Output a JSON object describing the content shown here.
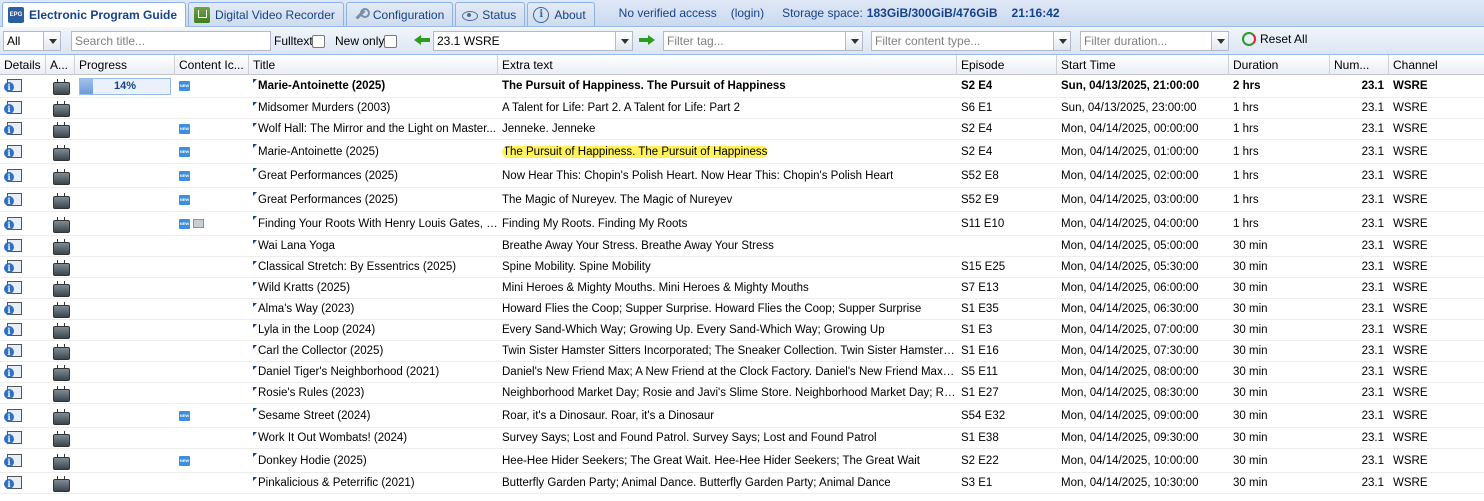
{
  "tabs": [
    {
      "label": "Electronic Program Guide",
      "icon": "epg-icon",
      "icon_text": "EPG",
      "active": true
    },
    {
      "label": "Digital Video Recorder",
      "icon": "dvr-icon",
      "active": false
    },
    {
      "label": "Configuration",
      "icon": "wrench-icon",
      "active": false
    },
    {
      "label": "Status",
      "icon": "eye-icon",
      "active": false
    },
    {
      "label": "About",
      "icon": "info-icon",
      "active": false
    }
  ],
  "status_bar": {
    "access": "No verified access",
    "login": "(login)",
    "storage_label": "Storage space:",
    "storage_value": "183GiB/300GiB/476GiB",
    "clock": "21:16:42"
  },
  "toolbar": {
    "channel_tag_value": "All",
    "search_placeholder": "Search title...",
    "fulltext_label": "Fulltext",
    "new_only_label": "New only",
    "channel_value": "23.1 WSRE",
    "tag_placeholder": "Filter tag...",
    "content_type_placeholder": "Filter content type...",
    "duration_placeholder": "Filter duration...",
    "reset_label": "Reset All"
  },
  "columns": [
    "Details",
    "A...",
    "Progress",
    "Content Ic...",
    "Title",
    "Extra text",
    "Episode",
    "Start Time",
    "Duration",
    "Num...",
    "Channel"
  ],
  "rows": [
    {
      "title": "Marie-Antoinette (2025)",
      "extra": "The Pursuit of Happiness. The Pursuit of Happiness",
      "episode": "S2 E4",
      "start": "Sun, 04/13/2025, 21:00:00",
      "duration": "2 hrs",
      "num": "23.1",
      "channel": "WSRE",
      "bold": true,
      "progress": 14,
      "progress_label": "14%",
      "new": true,
      "cc": false,
      "highlight": false
    },
    {
      "title": "Midsomer Murders (2003)",
      "extra": "A Talent for Life: Part 2. A Talent for Life: Part 2",
      "episode": "S6 E1",
      "start": "Sun, 04/13/2025, 23:00:00",
      "duration": "1 hrs",
      "num": "23.1",
      "channel": "WSRE",
      "bold": false,
      "new": false,
      "cc": false,
      "highlight": false
    },
    {
      "title": "Wolf Hall: The Mirror and the Light on Master...",
      "extra": "Jenneke. Jenneke",
      "episode": "S2 E4",
      "start": "Mon, 04/14/2025, 00:00:00",
      "duration": "1 hrs",
      "num": "23.1",
      "channel": "WSRE",
      "bold": false,
      "new": true,
      "cc": false,
      "highlight": false
    },
    {
      "title": "Marie-Antoinette (2025)",
      "extra": "The Pursuit of Happiness. The Pursuit of Happiness",
      "episode": "S2 E4",
      "start": "Mon, 04/14/2025, 01:00:00",
      "duration": "1 hrs",
      "num": "23.1",
      "channel": "WSRE",
      "bold": false,
      "new": true,
      "cc": false,
      "highlight": true
    },
    {
      "title": "Great Performances (2025)",
      "extra": "Now Hear This: Chopin's Polish Heart. Now Hear This: Chopin's Polish Heart",
      "episode": "S52 E8",
      "start": "Mon, 04/14/2025, 02:00:00",
      "duration": "1 hrs",
      "num": "23.1",
      "channel": "WSRE",
      "bold": false,
      "new": true,
      "cc": false,
      "highlight": false
    },
    {
      "title": "Great Performances (2025)",
      "extra": "The Magic of Nureyev. The Magic of Nureyev",
      "episode": "S52 E9",
      "start": "Mon, 04/14/2025, 03:00:00",
      "duration": "1 hrs",
      "num": "23.1",
      "channel": "WSRE",
      "bold": false,
      "new": true,
      "cc": false,
      "highlight": false
    },
    {
      "title": "Finding Your Roots With Henry Louis Gates, J...",
      "extra": "Finding My Roots. Finding My Roots",
      "episode": "S11 E10",
      "start": "Mon, 04/14/2025, 04:00:00",
      "duration": "1 hrs",
      "num": "23.1",
      "channel": "WSRE",
      "bold": false,
      "new": true,
      "cc": true,
      "highlight": false
    },
    {
      "title": "Wai Lana Yoga",
      "extra": "Breathe Away Your Stress. Breathe Away Your Stress",
      "episode": "",
      "start": "Mon, 04/14/2025, 05:00:00",
      "duration": "30 min",
      "num": "23.1",
      "channel": "WSRE",
      "bold": false,
      "new": false,
      "cc": false,
      "highlight": false
    },
    {
      "title": "Classical Stretch: By Essentrics (2025)",
      "extra": "Spine Mobility. Spine Mobility",
      "episode": "S15 E25",
      "start": "Mon, 04/14/2025, 05:30:00",
      "duration": "30 min",
      "num": "23.1",
      "channel": "WSRE",
      "bold": false,
      "new": false,
      "cc": false,
      "highlight": false
    },
    {
      "title": "Wild Kratts (2025)",
      "extra": "Mini Heroes & Mighty Mouths. Mini Heroes & Mighty Mouths",
      "episode": "S7 E13",
      "start": "Mon, 04/14/2025, 06:00:00",
      "duration": "30 min",
      "num": "23.1",
      "channel": "WSRE",
      "bold": false,
      "new": false,
      "cc": false,
      "highlight": false
    },
    {
      "title": "Alma's Way (2023)",
      "extra": "Howard Flies the Coop; Supper Surprise. Howard Flies the Coop; Supper Surprise",
      "episode": "S1 E35",
      "start": "Mon, 04/14/2025, 06:30:00",
      "duration": "30 min",
      "num": "23.1",
      "channel": "WSRE",
      "bold": false,
      "new": false,
      "cc": false,
      "highlight": false
    },
    {
      "title": "Lyla in the Loop (2024)",
      "extra": "Every Sand-Which Way; Growing Up. Every Sand-Which Way; Growing Up",
      "episode": "S1 E3",
      "start": "Mon, 04/14/2025, 07:00:00",
      "duration": "30 min",
      "num": "23.1",
      "channel": "WSRE",
      "bold": false,
      "new": false,
      "cc": false,
      "highlight": false
    },
    {
      "title": "Carl the Collector (2025)",
      "extra": "Twin Sister Hamster Sitters Incorporated; The Sneaker Collection. Twin Sister Hamster Sit...",
      "episode": "S1 E16",
      "start": "Mon, 04/14/2025, 07:30:00",
      "duration": "30 min",
      "num": "23.1",
      "channel": "WSRE",
      "bold": false,
      "new": false,
      "cc": false,
      "highlight": false
    },
    {
      "title": "Daniel Tiger's Neighborhood (2021)",
      "extra": "Daniel's New Friend Max; A New Friend at the Clock Factory. Daniel's New Friend Max; A ...",
      "episode": "S5 E11",
      "start": "Mon, 04/14/2025, 08:00:00",
      "duration": "30 min",
      "num": "23.1",
      "channel": "WSRE",
      "bold": false,
      "new": false,
      "cc": false,
      "highlight": false
    },
    {
      "title": "Rosie's Rules (2023)",
      "extra": "Neighborhood Market Day; Rosie and Javi's Slime Store. Neighborhood Market Day; Rosi...",
      "episode": "S1 E27",
      "start": "Mon, 04/14/2025, 08:30:00",
      "duration": "30 min",
      "num": "23.1",
      "channel": "WSRE",
      "bold": false,
      "new": false,
      "cc": false,
      "highlight": false
    },
    {
      "title": "Sesame Street (2024)",
      "extra": "Roar, it's a Dinosaur. Roar, it's a Dinosaur",
      "episode": "S54 E32",
      "start": "Mon, 04/14/2025, 09:00:00",
      "duration": "30 min",
      "num": "23.1",
      "channel": "WSRE",
      "bold": false,
      "new": true,
      "cc": false,
      "highlight": false
    },
    {
      "title": "Work It Out Wombats! (2024)",
      "extra": "Survey Says; Lost and Found Patrol. Survey Says; Lost and Found Patrol",
      "episode": "S1 E38",
      "start": "Mon, 04/14/2025, 09:30:00",
      "duration": "30 min",
      "num": "23.1",
      "channel": "WSRE",
      "bold": false,
      "new": false,
      "cc": false,
      "highlight": false
    },
    {
      "title": "Donkey Hodie (2025)",
      "extra": "Hee-Hee Hider Seekers; The Great Wait. Hee-Hee Hider Seekers; The Great Wait",
      "episode": "S2 E22",
      "start": "Mon, 04/14/2025, 10:00:00",
      "duration": "30 min",
      "num": "23.1",
      "channel": "WSRE",
      "bold": false,
      "new": true,
      "cc": false,
      "highlight": false
    },
    {
      "title": "Pinkalicious & Peterrific (2021)",
      "extra": "Butterfly Garden Party; Animal Dance. Butterfly Garden Party; Animal Dance",
      "episode": "S3 E1",
      "start": "Mon, 04/14/2025, 10:30:00",
      "duration": "30 min",
      "num": "23.1",
      "channel": "WSRE",
      "bold": false,
      "new": false,
      "cc": false,
      "highlight": false
    }
  ]
}
